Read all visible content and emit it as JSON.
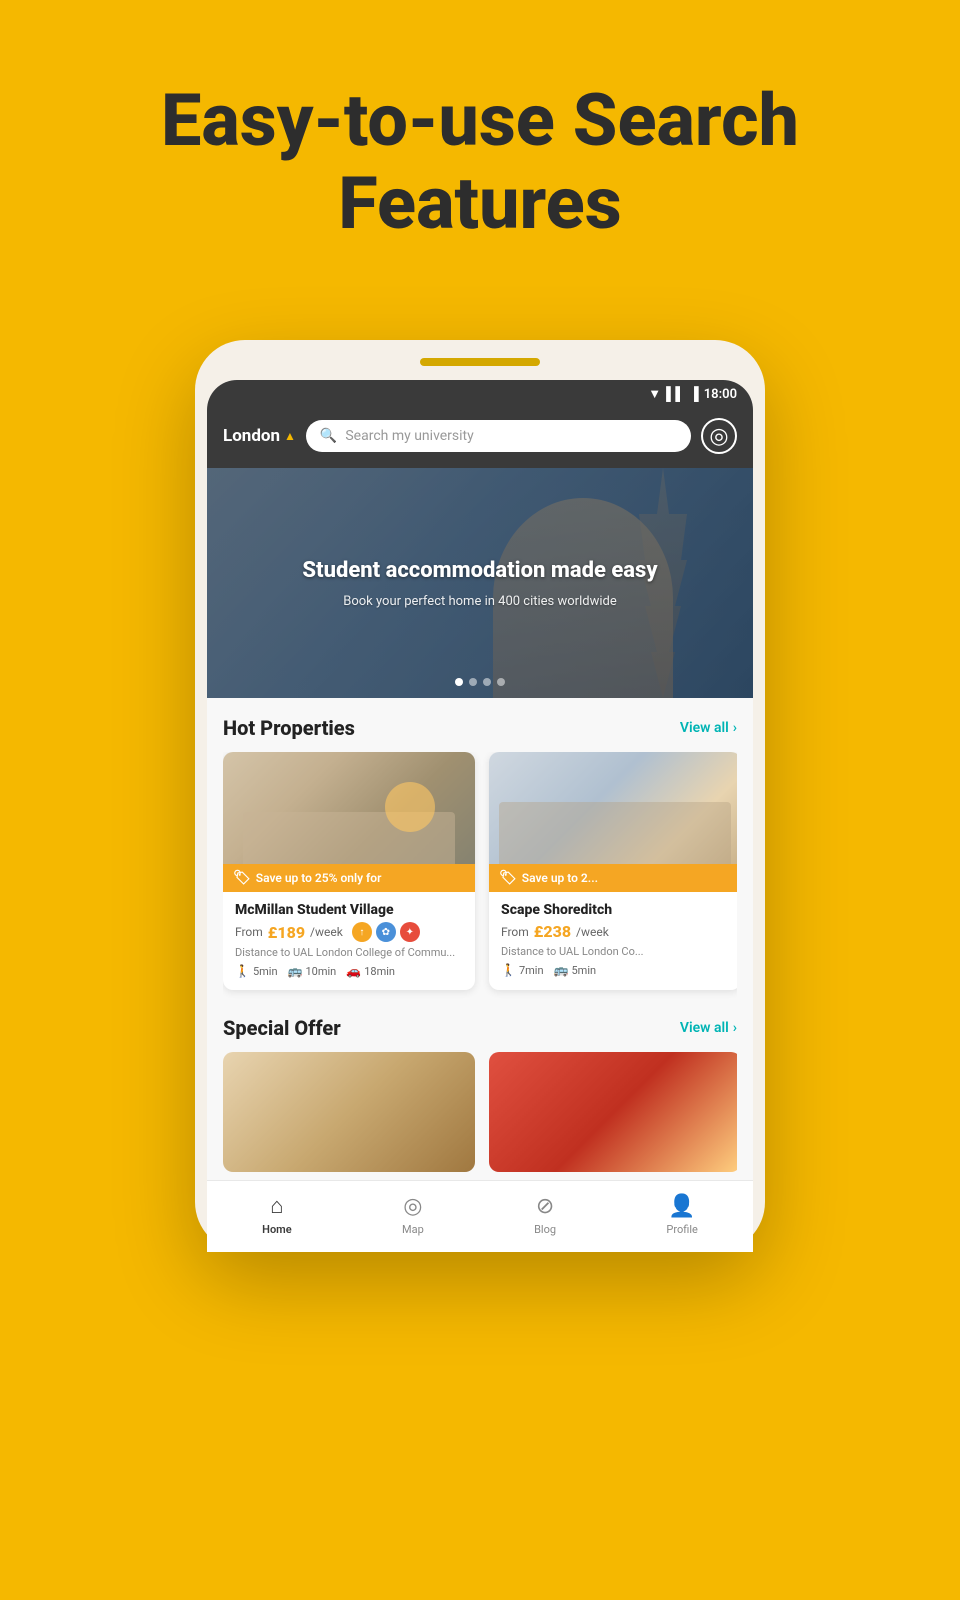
{
  "hero": {
    "title_line1": "Easy-to-use Search",
    "title_line2": "Features"
  },
  "phone": {
    "status_bar": {
      "time": "18:00"
    },
    "search_area": {
      "city": "London",
      "city_arrow": "▲",
      "search_placeholder": "Search my university"
    },
    "banner": {
      "title": "Student accommodation made easy",
      "subtitle": "Book your perfect home in 400 cities worldwide",
      "dots": [
        true,
        false,
        false,
        false
      ]
    },
    "hot_properties": {
      "section_title": "Hot Properties",
      "view_all": "View all",
      "properties": [
        {
          "name": "McMillan Student Village",
          "price_from": "From",
          "price": "£189",
          "price_per": "/week",
          "distance": "Distance to UAL London College of Commu...",
          "walk_time": "5min",
          "transit_time": "10min",
          "drive_time": "18min",
          "save_badge": "Save up to 25% only for"
        },
        {
          "name": "Scape Shoreditch",
          "price_from": "From",
          "price": "£238",
          "price_per": "/week",
          "distance": "Distance to UAL London Co...",
          "walk_time": "7min",
          "transit_time": "5min",
          "save_badge": "Save up to 2..."
        }
      ]
    },
    "special_offer": {
      "section_title": "Special Offer",
      "view_all": "View all"
    },
    "bottom_nav": {
      "items": [
        {
          "label": "Home",
          "icon": "⌂",
          "active": true
        },
        {
          "label": "Map",
          "icon": "◎",
          "active": false
        },
        {
          "label": "Blog",
          "icon": "⊘",
          "active": false
        },
        {
          "label": "Profile",
          "icon": "👤",
          "active": false
        }
      ]
    }
  }
}
